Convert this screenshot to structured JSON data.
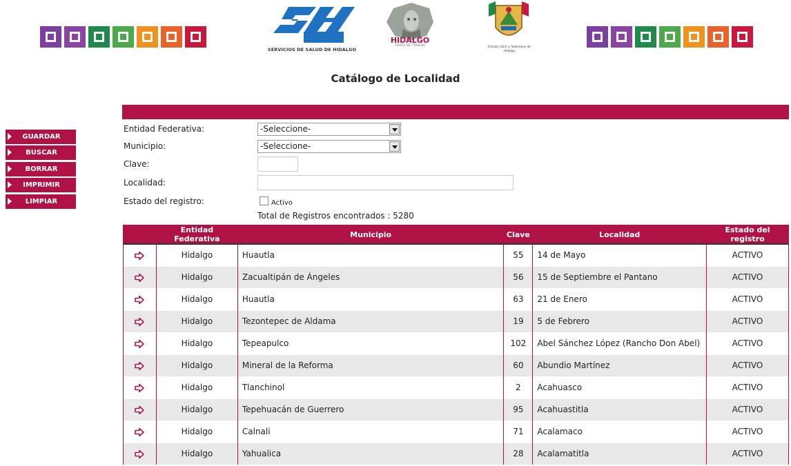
{
  "colors": {
    "brand": "#b01245",
    "deco": [
      "#7a3fa0",
      "#8a44a4",
      "#1f8a4c",
      "#4caa4a",
      "#f0921e",
      "#e8622a",
      "#c9183e"
    ]
  },
  "logos": {
    "ssh_caption": "SERVICIOS DE SALUD DE HIDALGO",
    "hidalgo_name": "HIDALGO",
    "hidalgo_tagline": "TIERRA DE TRABAJO",
    "escudo_caption": "Estado Libre y Soberano de Hidalgo"
  },
  "page_title": "Catálogo de Localidad",
  "side_menu": [
    {
      "label": "GUARDAR"
    },
    {
      "label": "BUSCAR"
    },
    {
      "label": "BORRAR"
    },
    {
      "label": "IMPRIMIR"
    },
    {
      "label": "LIMPIAR"
    }
  ],
  "form": {
    "entidad_label": "Entidad Federativa:",
    "entidad_value": "-Seleccione-",
    "municipio_label": "Municipio:",
    "municipio_value": "-Seleccione-",
    "clave_label": "Clave:",
    "clave_value": "",
    "localidad_label": "Localidad:",
    "localidad_value": "",
    "estado_label": "Estado del registro:",
    "activo_label": "Activo",
    "total_text": "Total de Registros encontrados : 5280"
  },
  "table": {
    "headers": [
      "",
      "Entidad Federativa",
      "Municipio",
      "Clave",
      "Localidad",
      "Estado del registro"
    ],
    "rows": [
      {
        "entidad": "Hidalgo",
        "municipio": "Huautla",
        "clave": "55",
        "localidad": "14 de Mayo",
        "estado": "ACTIVO"
      },
      {
        "entidad": "Hidalgo",
        "municipio": "Zacualtipán de Ángeles",
        "clave": "56",
        "localidad": "15 de Septiembre el Pantano",
        "estado": "ACTIVO"
      },
      {
        "entidad": "Hidalgo",
        "municipio": "Huautla",
        "clave": "63",
        "localidad": "21 de Enero",
        "estado": "ACTIVO"
      },
      {
        "entidad": "Hidalgo",
        "municipio": "Tezontepec de Aldama",
        "clave": "19",
        "localidad": "5 de Febrero",
        "estado": "ACTIVO"
      },
      {
        "entidad": "Hidalgo",
        "municipio": "Tepeapulco",
        "clave": "102",
        "localidad": "Abel Sánchez López (Rancho Don Abel)",
        "estado": "ACTIVO"
      },
      {
        "entidad": "Hidalgo",
        "municipio": "Mineral de la Reforma",
        "clave": "60",
        "localidad": "Abundio Martínez",
        "estado": "ACTIVO"
      },
      {
        "entidad": "Hidalgo",
        "municipio": "Tlanchinol",
        "clave": "2",
        "localidad": "Acahuasco",
        "estado": "ACTIVO"
      },
      {
        "entidad": "Hidalgo",
        "municipio": "Tepehuacán de Guerrero",
        "clave": "95",
        "localidad": "Acahuastitla",
        "estado": "ACTIVO"
      },
      {
        "entidad": "Hidalgo",
        "municipio": "Calnali",
        "clave": "71",
        "localidad": "Acalamaco",
        "estado": "ACTIVO"
      },
      {
        "entidad": "Hidalgo",
        "municipio": "Yahualica",
        "clave": "28",
        "localidad": "Acalamatitla",
        "estado": "ACTIVO"
      }
    ]
  }
}
